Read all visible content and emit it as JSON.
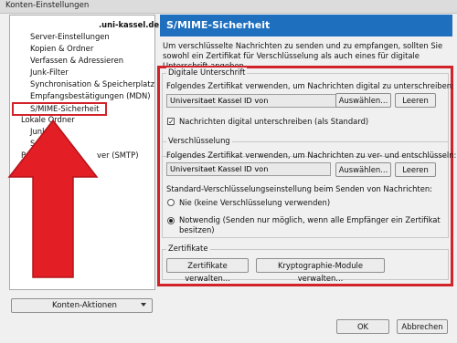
{
  "window": {
    "title": "Konten-Einstellungen"
  },
  "sidebar": {
    "account": ".uni-kassel.de",
    "items": [
      "Server-Einstellungen",
      "Kopien & Ordner",
      "Verfassen & Adressieren",
      "Junk-Filter",
      "Synchronisation & Speicherplatz",
      "Empfangsbestätigungen (MDN)",
      "S/MIME-Sicherheit"
    ],
    "local_folders": "Lokale Ordner",
    "local_items": [
      "Junk-F",
      "Spei"
    ],
    "outgoing": "Postausgang-Server (SMTP)",
    "outgoing_visible_left": "Post",
    "outgoing_visible_right": "ver (SMTP)",
    "actions_button": "Konten-Aktionen"
  },
  "panel": {
    "title": "S/MIME-Sicherheit",
    "description": "Um verschlüsselte Nachrichten zu senden und zu empfangen, sollten Sie sowohl ein Zertifikat für Verschlüsselung als auch eines für digitale Unterschrift angeben.",
    "signature": {
      "legend": "Digitale Unterschrift",
      "instruction": "Folgendes Zertifikat verwenden, um Nachrichten digital zu unterschreiben:",
      "cert_value": "Universitaet Kassel ID von",
      "select_button": "Auswählen...",
      "clear_button": "Leeren",
      "checkbox_label": "Nachrichten digital unterschreiben (als Standard)",
      "checkbox_checked": true
    },
    "encryption": {
      "legend": "Verschlüsselung",
      "instruction": "Folgendes Zertifikat verwenden, um Nachrichten zu ver- und entschlüsseln:",
      "cert_value": "Universitaet Kassel ID von",
      "select_button": "Auswählen...",
      "clear_button": "Leeren",
      "default_setting_label": "Standard-Verschlüsselungseinstellung beim Senden von Nachrichten:",
      "option_never": "Nie (keine Verschlüsselung verwenden)",
      "option_required_line1": "Notwendig (Senden nur möglich, wenn alle Empfänger ein Zertifikat",
      "option_required_line2": "besitzen)",
      "selected": "required"
    },
    "certificates": {
      "legend": "Zertifikate",
      "manage_button": "Zertifikate verwalten...",
      "crypto_button": "Kryptographie-Module verwalten..."
    }
  },
  "footer": {
    "ok": "OK",
    "cancel": "Abbrechen"
  },
  "colors": {
    "accent_header": "#1f6fbf",
    "highlight_red": "#d2232a"
  }
}
